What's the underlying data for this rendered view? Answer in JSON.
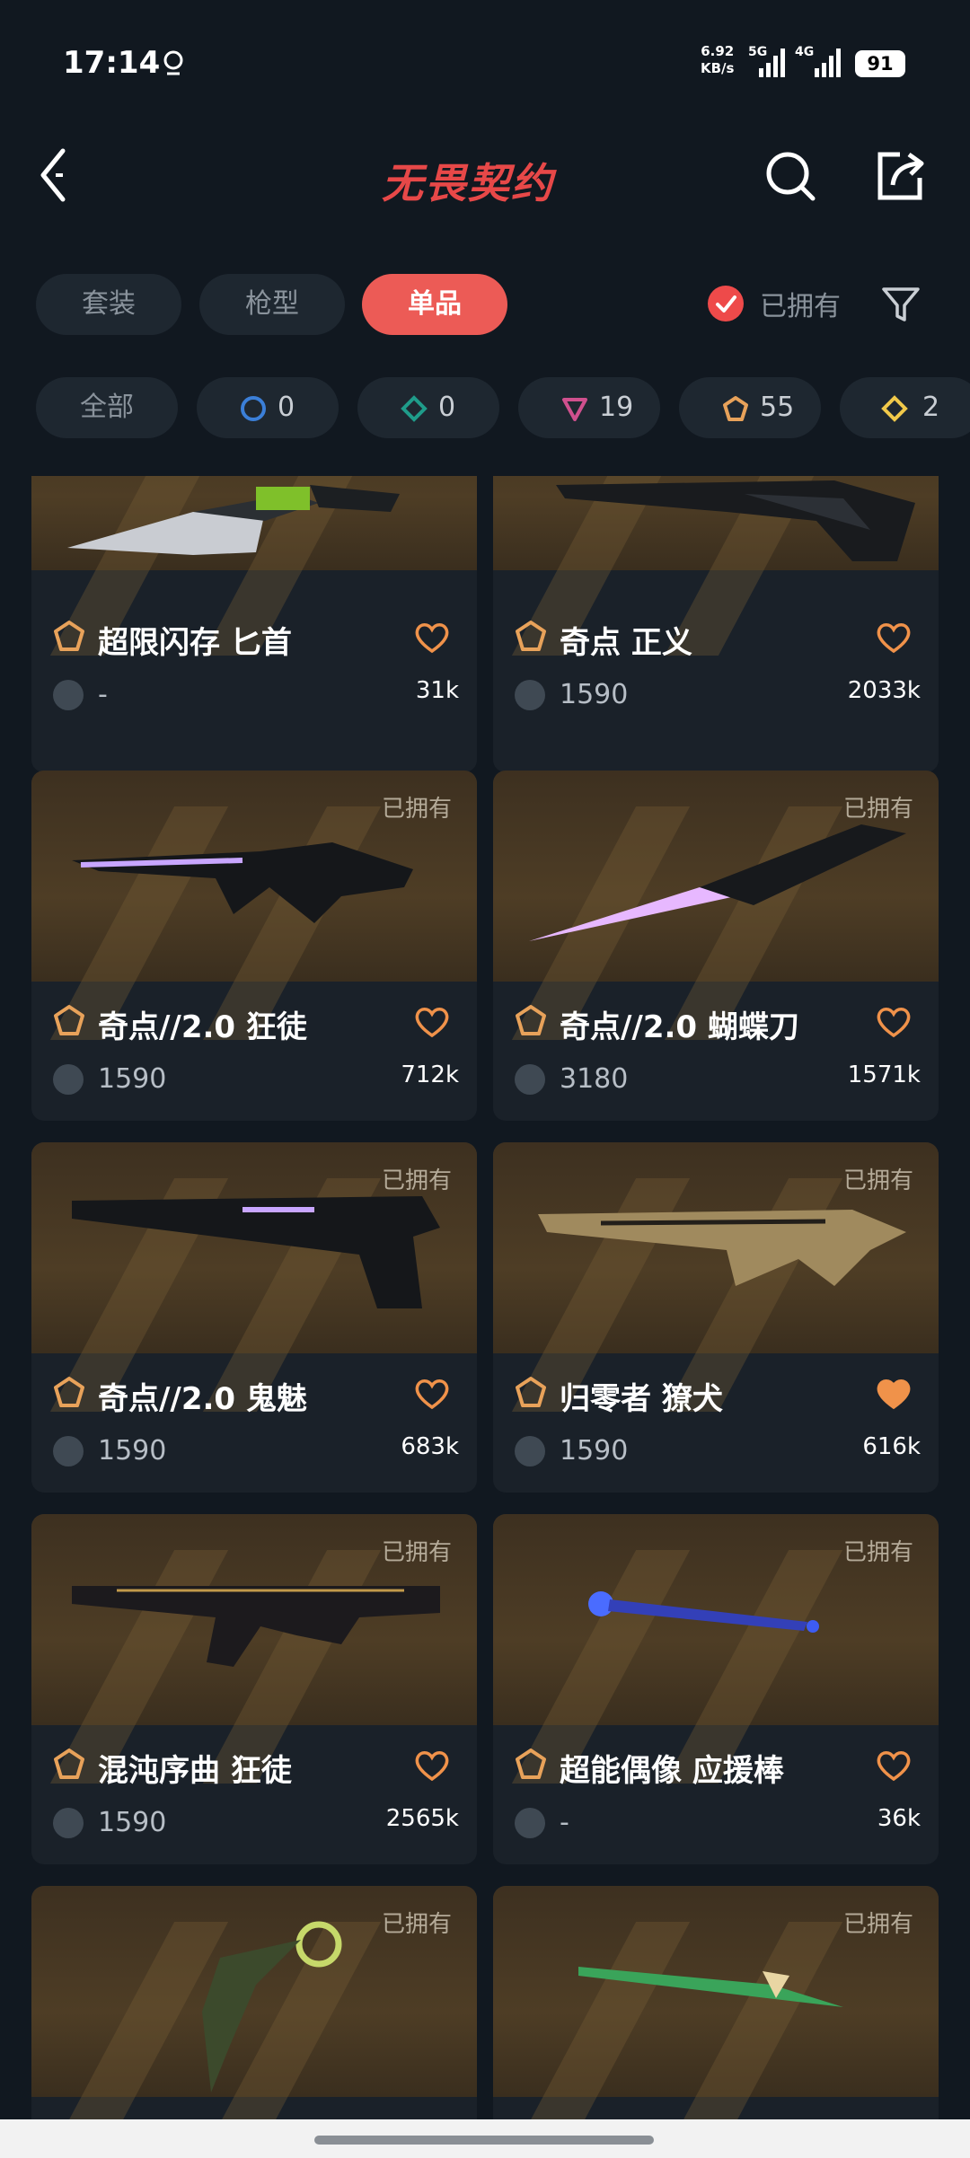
{
  "status_bar": {
    "time": "17:14",
    "net_speed_value": "6.92",
    "net_speed_unit": "KB/s",
    "net_5g": "5G",
    "net_4g": "4G",
    "battery": "91"
  },
  "header": {
    "title": "无畏契约"
  },
  "tabs": [
    {
      "label": "套装",
      "active": false
    },
    {
      "label": "枪型",
      "active": false
    },
    {
      "label": "单品",
      "active": true
    }
  ],
  "owned_filter": {
    "label": "已拥有",
    "checked": true
  },
  "rarity_chips": [
    {
      "label": "全部"
    },
    {
      "icon": "select-tier-icon",
      "count": "0",
      "color": "#3b7fd8"
    },
    {
      "icon": "deluxe-tier-icon",
      "count": "0",
      "color": "#1f9c8a"
    },
    {
      "icon": "premium-tier-icon",
      "count": "19",
      "color": "#d0508e"
    },
    {
      "icon": "exclusive-tier-icon",
      "count": "55",
      "color": "#e8a25a"
    },
    {
      "icon": "ultra-tier-icon",
      "count": "2",
      "color": "#f1c94a"
    }
  ],
  "owned_tag": "已拥有",
  "items": [
    {
      "name": "超限闪存 匕首",
      "price": "-",
      "likes": "31k",
      "owned": false,
      "favorited": false
    },
    {
      "name": "奇点 正义",
      "price": "1590",
      "likes": "2033k",
      "owned": false,
      "favorited": false
    },
    {
      "name": "奇点//2.0 狂徒",
      "price": "1590",
      "likes": "712k",
      "owned": true,
      "favorited": false
    },
    {
      "name": "奇点//2.0 蝴蝶刀",
      "price": "3180",
      "likes": "1571k",
      "owned": true,
      "favorited": false
    },
    {
      "name": "奇点//2.0 鬼魅",
      "price": "1590",
      "likes": "683k",
      "owned": true,
      "favorited": false
    },
    {
      "name": "归零者 獠犬",
      "price": "1590",
      "likes": "616k",
      "owned": true,
      "favorited": true
    },
    {
      "name": "混沌序曲 狂徒",
      "price": "1590",
      "likes": "2565k",
      "owned": true,
      "favorited": false
    },
    {
      "name": "超能偶像 应援棒",
      "price": "-",
      "likes": "36k",
      "owned": true,
      "favorited": false
    },
    {
      "name": "",
      "price": "",
      "likes": "",
      "owned": true,
      "favorited": false
    },
    {
      "name": "",
      "price": "",
      "likes": "",
      "owned": true,
      "favorited": false
    }
  ],
  "colors": {
    "accent": "#ec5b56",
    "heart": "#f0924a",
    "background": "#111820"
  }
}
